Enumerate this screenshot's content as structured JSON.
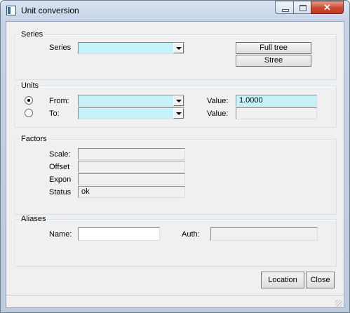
{
  "window": {
    "title": "Unit conversion"
  },
  "series": {
    "legend": "Series",
    "label": "Series",
    "value": "",
    "full_tree_button": "Full tree",
    "stree_button": "Stree"
  },
  "units": {
    "legend": "Units",
    "from_label": "From:",
    "to_label": "To:",
    "from_value": "",
    "to_value": "",
    "value1_label": "Value:",
    "value1": "1.0000",
    "value2_label": "Value:",
    "value2": "",
    "selected_radio": "from"
  },
  "factors": {
    "legend": "Factors",
    "scale_label": "Scale:",
    "scale": "",
    "offset_label": "Offset",
    "offset": "",
    "expon_label": "Expon",
    "expon": "",
    "status_label": "Status",
    "status": "ok"
  },
  "aliases": {
    "legend": "Aliases",
    "name_label": "Name:",
    "name": "",
    "auth_label": "Auth:",
    "auth": ""
  },
  "buttons": {
    "location": "Location",
    "close": "Close"
  }
}
